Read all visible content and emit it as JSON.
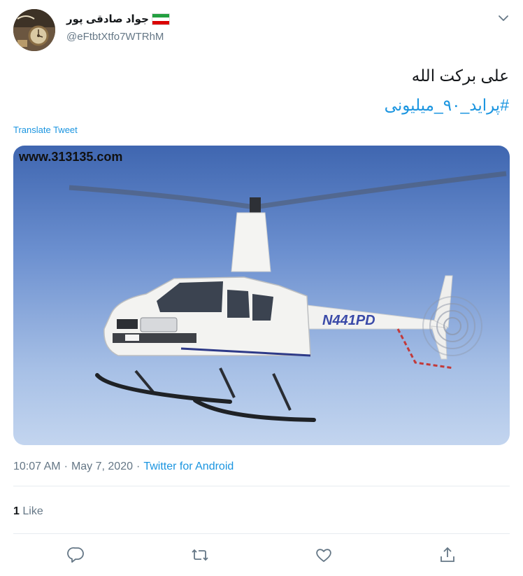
{
  "tweet": {
    "author_name": "جواد صادقی پور",
    "author_handle": "@eFtbtXtfo7WTRhM",
    "text": "علی برکت الله",
    "hashtag": "#پراید_۹۰_میلیونی",
    "translate_label": "Translate Tweet",
    "time": "10:07 AM",
    "date": "May 7, 2020",
    "separator": "·",
    "source": "Twitter for Android",
    "like_count": "1",
    "like_label": "Like"
  },
  "media": {
    "watermark": "www.313135.com",
    "tail_number": "N441PD"
  },
  "icons": {
    "menu": "chevron-down-icon",
    "reply": "reply-icon",
    "retweet": "retweet-icon",
    "like": "heart-icon",
    "share": "share-icon"
  },
  "colors": {
    "accent": "#1b95e0",
    "secondary_text": "#657786",
    "divider": "#e6ecf0"
  }
}
